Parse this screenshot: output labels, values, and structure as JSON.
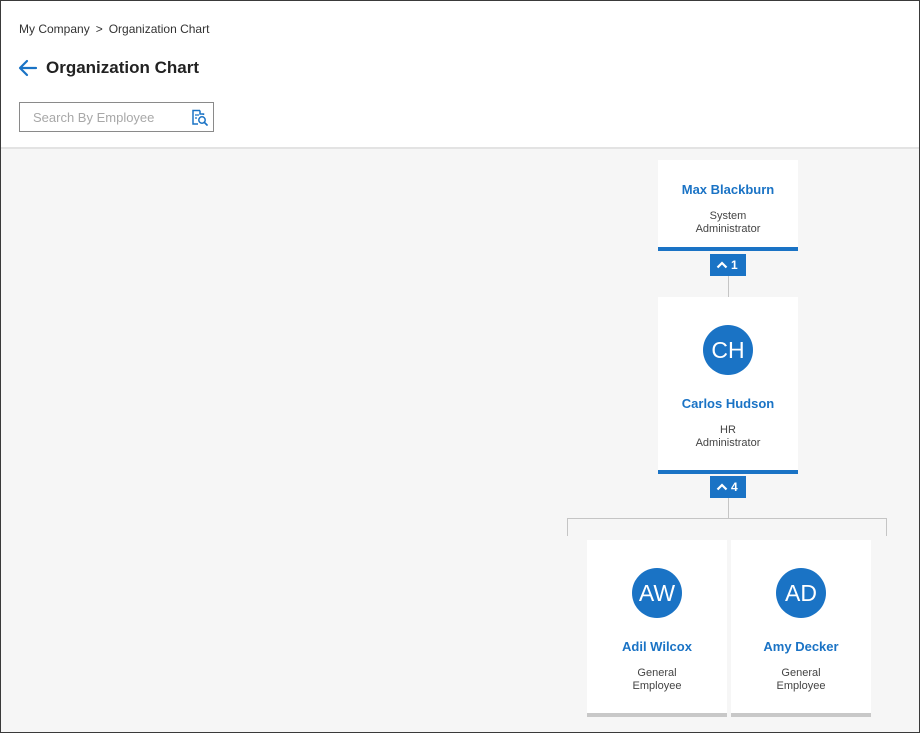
{
  "breadcrumb": {
    "root": "My Company",
    "separator": ">",
    "current": "Organization Chart"
  },
  "page": {
    "title": "Organization Chart",
    "back_icon": "arrow-left-icon"
  },
  "search": {
    "placeholder": "Search By Employee",
    "value": "",
    "icon": "search-document-icon"
  },
  "colors": {
    "accent": "#1a73c5",
    "canvas": "#f6f6f6",
    "connector": "#c5c5c5",
    "leaf_border": "#c8c8c8"
  },
  "org": {
    "top": {
      "name": "Max Blackburn",
      "role_line1": "System",
      "role_line2": "Administrator",
      "children_count": "1"
    },
    "mid": {
      "initials": "CH",
      "name": "Carlos Hudson",
      "role_line1": "HR",
      "role_line2": "Administrator",
      "children_count": "4"
    },
    "children": [
      {
        "initials": "AW",
        "name": "Adil Wilcox",
        "role_line1": "General",
        "role_line2": "Employee"
      },
      {
        "initials": "AD",
        "name": "Amy Decker",
        "role_line1": "General",
        "role_line2": "Employee"
      }
    ]
  }
}
